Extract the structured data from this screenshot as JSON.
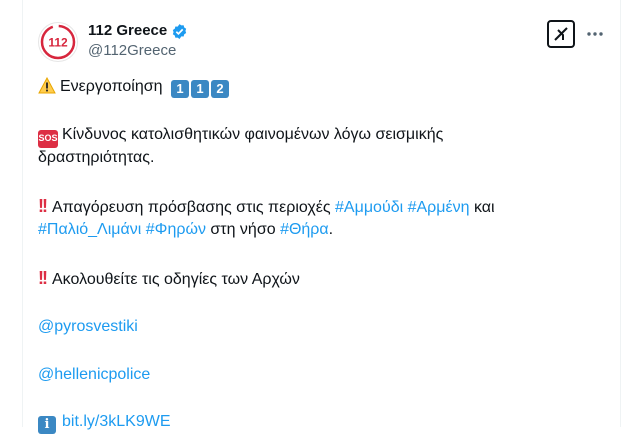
{
  "author": {
    "name": "112 Greece",
    "handle": "@112Greece",
    "avatar_text": "112",
    "brand_color": "#d7263d"
  },
  "tweet": {
    "line1_text": "Ενεργοποίηση",
    "line1_keys": [
      "1",
      "1",
      "2"
    ],
    "sos_label": "SOS",
    "para2_line1": "Κίνδυνος κατολισθητικών φαινομένων λόγω σεισμικής",
    "para2_line2": "δραστηριότητας.",
    "para3_lead": "Απαγόρευση πρόσβασης στις περιοχές",
    "hashtag_ammoudi": "#Αμμούδι",
    "hashtag_armeni": "#Αρμένη",
    "word_kai": "και",
    "hashtag_palio": "#Παλιό_Λιμάνι",
    "hashtag_fira": "#Φηρών",
    "word_sti_niso": "στη νήσο",
    "hashtag_thira": "#Θήρα",
    "period": ".",
    "para4_text": "Ακολουθείτε τις οδηγίες των Αρχών",
    "mention1": "@pyrosvestiki",
    "mention2": "@hellenicpolice",
    "link_text": "bit.ly/3kLK9WE",
    "info_glyph": "i"
  },
  "colors": {
    "link": "#1d9bf0",
    "text": "#0f1419",
    "secondary": "#536471"
  },
  "icons": [
    "verified-badge-icon",
    "grok-icon",
    "more-icon",
    "warning-icon",
    "sos-icon",
    "double-exclamation-icon",
    "info-icon"
  ]
}
